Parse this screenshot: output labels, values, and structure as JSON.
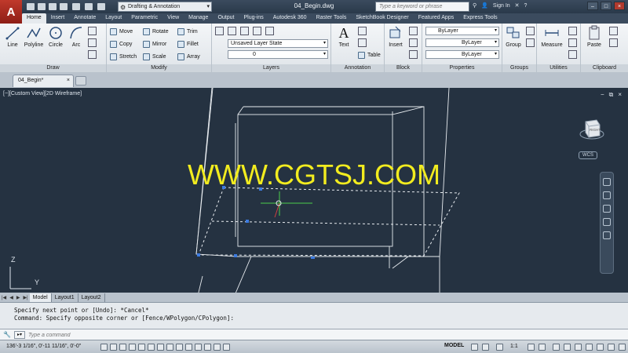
{
  "app": {
    "logo_letter": "A",
    "workspace": "Drafting & Annotation",
    "document_title": "04_Begin.dwg",
    "search_placeholder": "Type a keyword or phrase",
    "sign_in": "Sign In"
  },
  "ribbon_tabs": [
    "Home",
    "Insert",
    "Annotate",
    "Layout",
    "Parametric",
    "View",
    "Manage",
    "Output",
    "Plug-ins",
    "Autodesk 360",
    "Raster Tools",
    "SketchBook Designer",
    "Featured Apps",
    "Express Tools"
  ],
  "ribbon": {
    "draw": {
      "title": "Draw",
      "line": "Line",
      "polyline": "Polyline",
      "circle": "Circle",
      "arc": "Arc"
    },
    "modify": {
      "title": "Modify",
      "move": "Move",
      "rotate": "Rotate",
      "trim": "Trim",
      "copy": "Copy",
      "mirror": "Mirror",
      "fillet": "Fillet",
      "stretch": "Stretch",
      "scale": "Scale",
      "array": "Array"
    },
    "layers": {
      "title": "Layers",
      "layer_state": "Unsaved Layer State",
      "current_layer": "0"
    },
    "annotation": {
      "title": "Annotation",
      "text": "Text",
      "table": "Table"
    },
    "block": {
      "title": "Block",
      "insert": "Insert"
    },
    "properties": {
      "title": "Properties",
      "color": "ByLayer",
      "linetype": "ByLayer",
      "lineweight": "ByLayer"
    },
    "groups": {
      "title": "Groups",
      "group": "Group"
    },
    "utilities": {
      "title": "Utilities",
      "measure": "Measure"
    },
    "clipboard": {
      "title": "Clipboard",
      "paste": "Paste"
    }
  },
  "file_tab": {
    "name": "04_Begin*",
    "close": "×"
  },
  "viewport": {
    "label": "[−][Custom View][2D Wireframe]",
    "controls": [
      "−",
      "⧉",
      "×"
    ],
    "viewcube_face": "RIGHT",
    "wcs": "WCS",
    "watermark": "WWW.CGTSJ.COM",
    "axis_z": "Z",
    "axis_y": "Y"
  },
  "layout_tabs": [
    "Model",
    "Layout1",
    "Layout2"
  ],
  "command": {
    "history": [
      "Specify next point or [Undo]: *Cancel*",
      "Command: Specify opposite corner or [Fence/WPolygon/CPolygon]:"
    ],
    "placeholder": "Type a command"
  },
  "status": {
    "coords": "136'-3 1/16\", 0'-11 11/16\", 0'-0\"",
    "model": "MODEL",
    "scale": "1:1"
  },
  "colors": {
    "accent": "#c0392b",
    "viewport_bg": "#253241",
    "watermark": "#f2ec1f",
    "ribbon_bg": "#e6eaee"
  }
}
